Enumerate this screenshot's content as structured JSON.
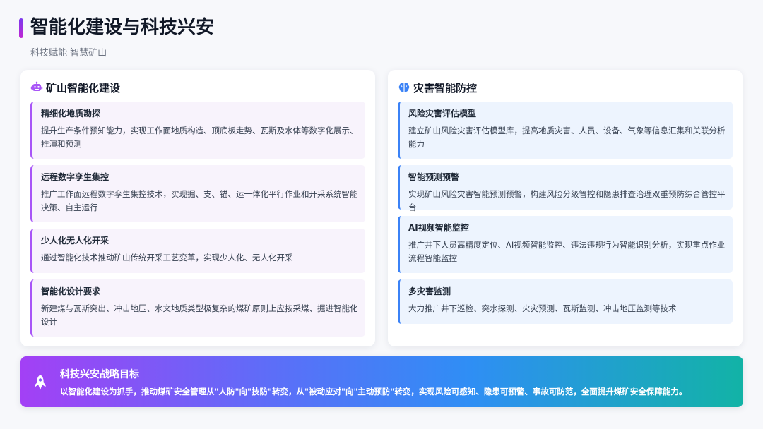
{
  "header": {
    "title": "智能化建设与科技兴安",
    "subtitle": "科技赋能 智慧矿山",
    "accent_color": "#8b5cf6"
  },
  "left_panel": {
    "icon": "robot-icon",
    "title": "矿山智能化建设",
    "accent_color": "#a855f7",
    "items": [
      {
        "title": "精细化地质勘探",
        "desc": "提升生产条件预知能力，实现工作面地质构造、顶底板走势、瓦斯及水体等数字化展示、推演和预测"
      },
      {
        "title": "远程数字孪生集控",
        "desc": "推广工作面远程数字孪生集控技术，实现掘、支、锚、运一体化平行作业和开采系统智能决策、自主运行"
      },
      {
        "title": "少人化无人化开采",
        "desc": "通过智能化技术推动矿山传统开采工艺变革，实现少人化、无人化开采"
      },
      {
        "title": "智能化设计要求",
        "desc": "新建煤与瓦斯突出、冲击地压、水文地质类型极复杂的煤矿原则上应按采煤、掘进智能化设计"
      }
    ]
  },
  "right_panel": {
    "icon": "brain-icon",
    "title": "灾害智能防控",
    "accent_color": "#3b82f6",
    "items": [
      {
        "title": "风险灾害评估模型",
        "desc": "建立矿山风险灾害评估模型库，提高地质灾害、人员、设备、气象等信息汇集和关联分析能力"
      },
      {
        "title": "智能预测预警",
        "desc": "实现矿山风险灾害智能预测预警，构建风险分级管控和隐患排查治理双重预防综合管控平台"
      },
      {
        "title": "AI视频智能监控",
        "desc": "推广井下人员高精度定位、AI视频智能监控、违法违规行为智能识别分析，实现重点作业流程智能监控"
      },
      {
        "title": "多灾害监测",
        "desc": "大力推广井下巡检、突水探测、火灾预测、瓦斯监测、冲击地压监测等技术"
      }
    ]
  },
  "banner": {
    "icon": "rocket-icon",
    "title": "科技兴安战略目标",
    "text": "以智能化建设为抓手，推动煤矿安全管理从\"人防\"向\"技防\"转变，从\"被动应对\"向\"主动预防\"转变，实现风险可感知、隐患可预警、事故可防范，全面提升煤矿安全保障能力。"
  }
}
